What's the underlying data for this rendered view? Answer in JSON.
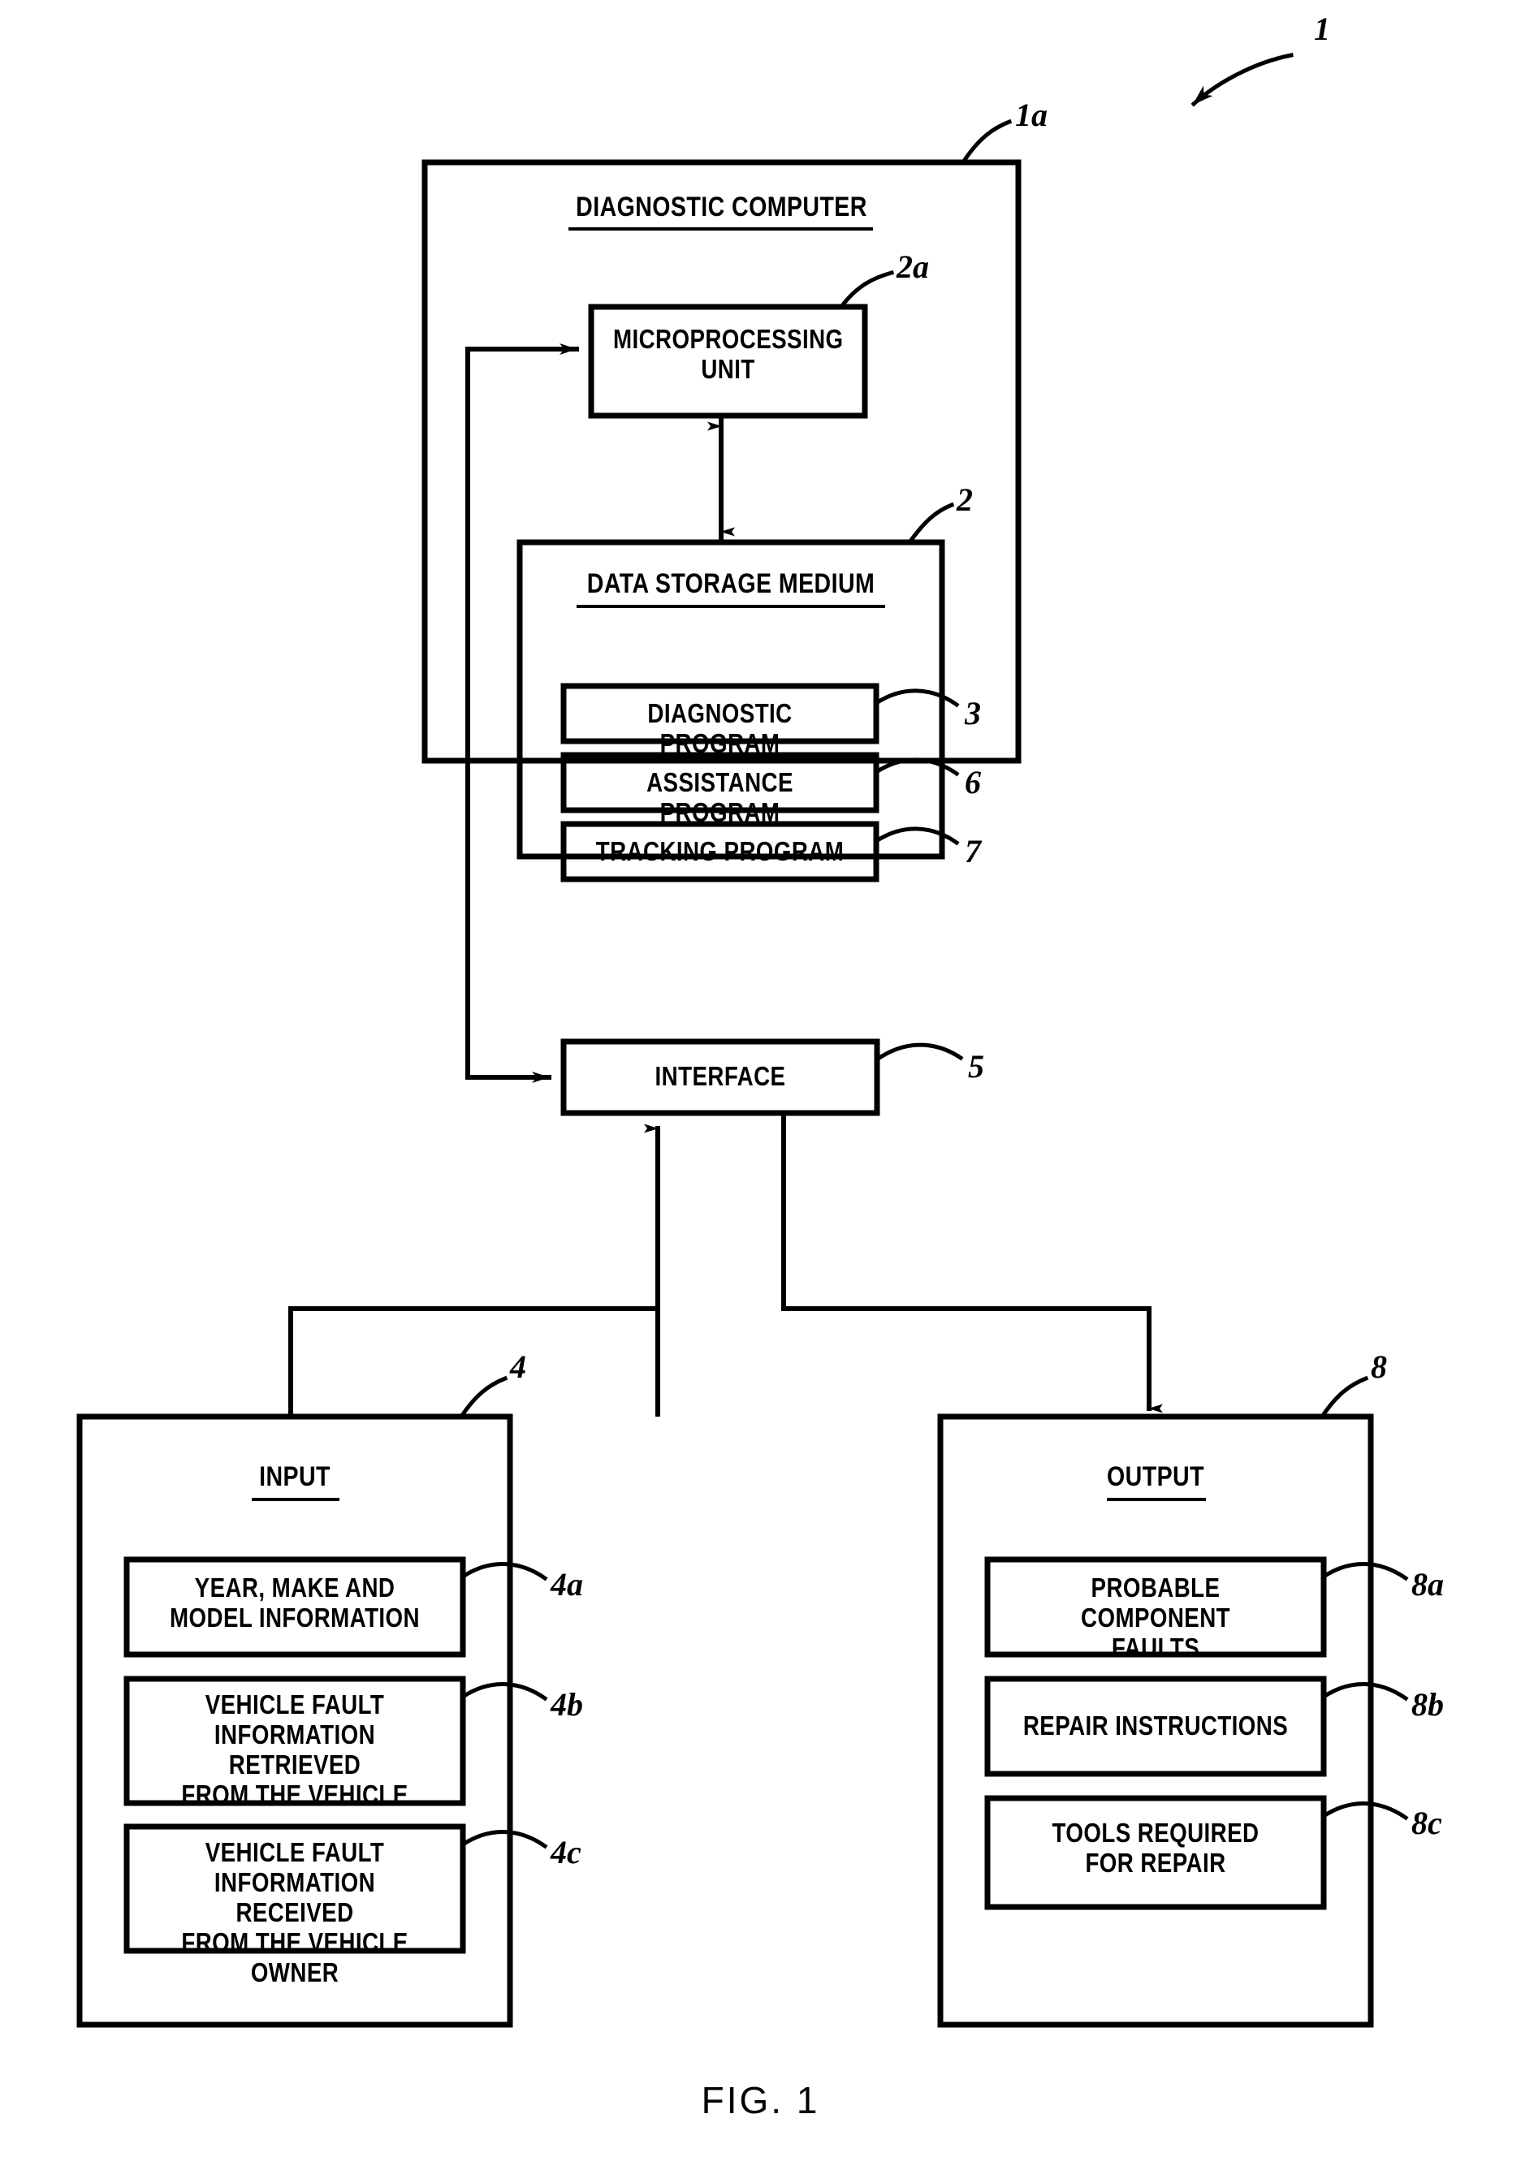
{
  "figure": {
    "caption": "FIG. 1",
    "top_reference": "1",
    "diagnostic_computer": {
      "title": "DIAGNOSTIC COMPUTER",
      "reference": "1a",
      "microprocessing_unit": {
        "label": "MICROPROCESSING\nUNIT",
        "reference": "2a"
      },
      "data_storage_medium": {
        "title": "DATA STORAGE MEDIUM",
        "reference": "2",
        "programs": [
          {
            "label": "DIAGNOSTIC PROGRAM",
            "reference": "3"
          },
          {
            "label": "ASSISTANCE PROGRAM",
            "reference": "6"
          },
          {
            "label": "TRACKING PROGRAM",
            "reference": "7"
          }
        ]
      },
      "interface": {
        "label": "INTERFACE",
        "reference": "5"
      }
    },
    "input": {
      "title": "INPUT",
      "reference": "4",
      "items": [
        {
          "label": "YEAR, MAKE AND\nMODEL INFORMATION",
          "reference": "4a"
        },
        {
          "label": "VEHICLE FAULT\nINFORMATION RETRIEVED\nFROM THE VEHICLE",
          "reference": "4b"
        },
        {
          "label": "VEHICLE FAULT\nINFORMATION RECEIVED\nFROM THE VEHICLE OWNER",
          "reference": "4c"
        }
      ]
    },
    "output": {
      "title": "OUTPUT",
      "reference": "8",
      "items": [
        {
          "label": "PROBABLE COMPONENT\nFAULTS",
          "reference": "8a"
        },
        {
          "label": "REPAIR INSTRUCTIONS",
          "reference": "8b"
        },
        {
          "label": "TOOLS REQUIRED\nFOR REPAIR",
          "reference": "8c"
        }
      ]
    }
  },
  "colors": {
    "ink": "#000000",
    "paper": "#ffffff"
  }
}
